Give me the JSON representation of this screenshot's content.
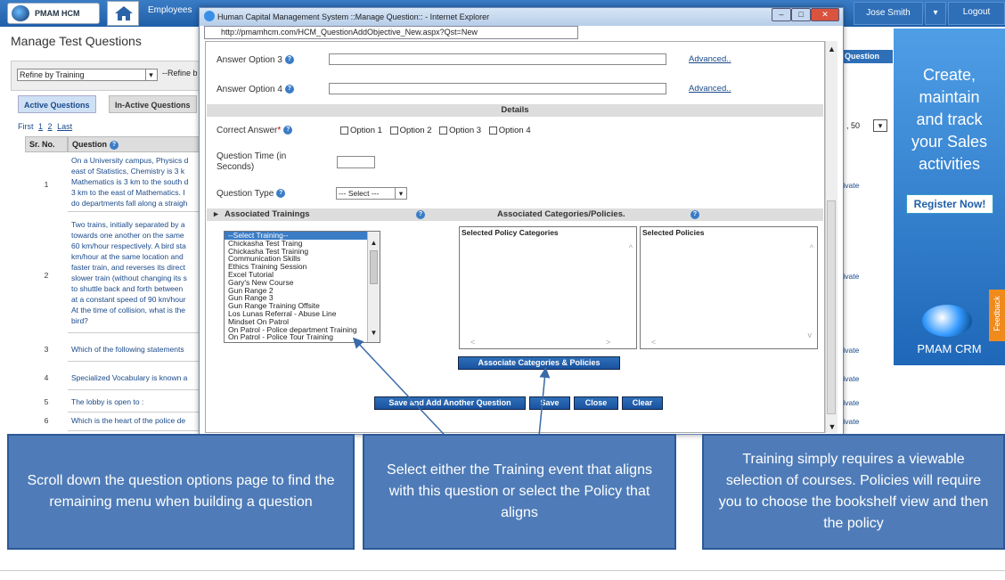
{
  "topbar": {
    "logo_text": "PMAM HCM",
    "menu": [
      "Employees"
    ],
    "user": "Jose Smith",
    "logout": "Logout"
  },
  "background_page": {
    "title": "Manage Test Questions",
    "refine_by": "Refine by Training",
    "refine2": "--Refine b",
    "tabs": [
      "Active Questions",
      "In-Active Questions"
    ],
    "pager": {
      "first": "First",
      "pages": [
        "1",
        "2"
      ],
      "last": "Last"
    },
    "page_size": "50",
    "table_headers": [
      "Sr. No.",
      "Question"
    ],
    "rows": [
      {
        "no": "1",
        "text": [
          "On a University campus, Physics d",
          "east of Statistics, Chemistry is 3 k",
          "Mathematics is 3 km to the south d",
          "3 km to the east of Mathematics. I",
          "do departments fall along a straigh"
        ],
        "action": "tivate"
      },
      {
        "no": "2",
        "text": [
          "Two trains, initially separated by a",
          "towards one another on the same",
          "60 km/hour respectively. A bird sta",
          "km/hour at the same location and",
          "faster train, and reverses its direct",
          "slower train (without changing its s",
          "to shuttle back and forth between",
          "at a constant speed of 90 km/hour",
          "At the time of collision, what is the",
          "bird?"
        ],
        "action": "tivate"
      },
      {
        "no": "3",
        "text": [
          "Which of the following statements"
        ],
        "action": "tivate"
      },
      {
        "no": "4",
        "text": [
          "Specialized Vocabulary is known a"
        ],
        "action": "tivate"
      },
      {
        "no": "5",
        "text": [
          "The lobby is open to :"
        ],
        "action": "tivate"
      },
      {
        "no": "6",
        "text": [
          "Which is the heart of the police de"
        ],
        "action": "tivate"
      }
    ],
    "right_header": "Question"
  },
  "ad": {
    "text": [
      "Create,",
      "maintain",
      "and track",
      "your Sales",
      "activities"
    ],
    "button": "Register Now!",
    "brand": "PMAM CRM",
    "feedback": "Feedback"
  },
  "popup": {
    "title": "Human Capital Management System ::Manage Question:: - Internet Explorer",
    "url": "http://pmamhcm.com/HCM_QuestionAddObjective_New.aspx?Qst=New",
    "answer_option_3": "Answer Option 3",
    "answer_option_4": "Answer Option 4",
    "advanced": "Advanced..",
    "details": "Details",
    "correct_answer": "Correct Answer",
    "options": [
      "Option 1",
      "Option 2",
      "Option 3",
      "Option 4"
    ],
    "question_time": [
      "Question Time (in",
      "Seconds)"
    ],
    "question_type": "Question Type",
    "question_type_value": "--- Select ---",
    "associated_trainings": "Associated Trainings",
    "associated_categories": "Associated Categories/Policies.",
    "trainings": [
      "--Select Training--",
      "Chickasha Test Traing",
      "Chickasha Test Training",
      "Communication Skills",
      "Ethics Training Session",
      "Excel Tutorial",
      "Gary's New Course",
      "Gun Range 2",
      "Gun Range 3",
      "Gun Range Training Offsite",
      "Los Lunas Referral - Abuse Line",
      "Mindset On Patrol",
      "On Patrol - Police department Training",
      "On Patrol - Police Tour Training"
    ],
    "selected_policy_categories": "Selected Policy Categories",
    "selected_policies": "Selected Policies",
    "associate_button": "Associate Categories & Policies",
    "buttons": {
      "save_add": "Save and Add Another Question",
      "save": "Save",
      "close": "Close",
      "clear": "Clear"
    }
  },
  "callouts": [
    "Scroll down the question options page to find the remaining menu when building a question",
    "Select either the Training event that aligns with this question or select the Policy that aligns",
    "Training simply requires a viewable selection of courses. Policies will require you to choose the bookshelf view and then the policy"
  ]
}
